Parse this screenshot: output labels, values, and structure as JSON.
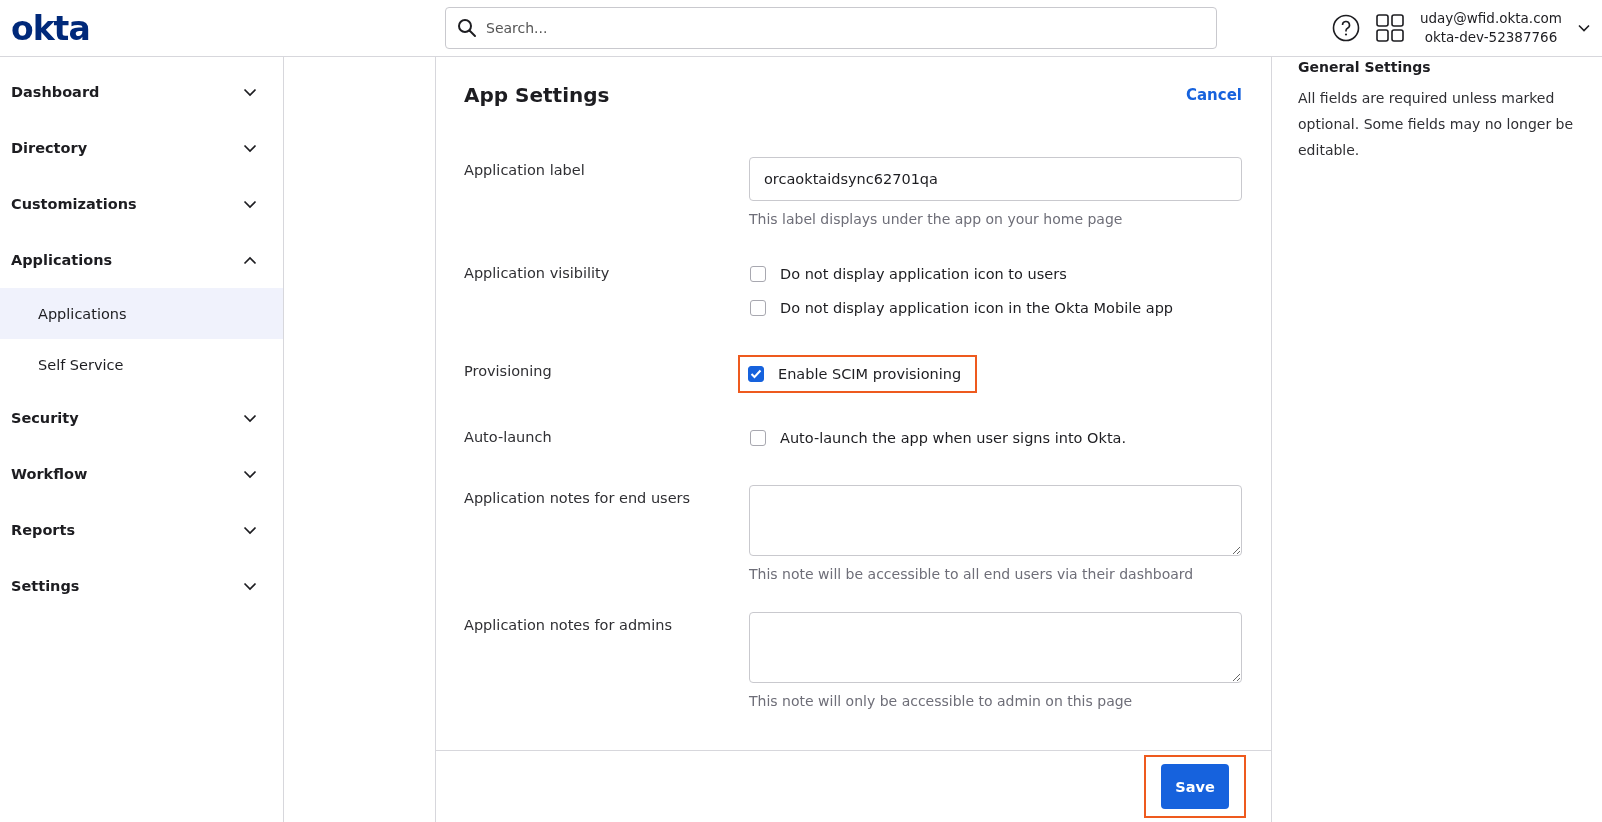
{
  "header": {
    "logo": "okta",
    "search": {
      "placeholder": "Search..."
    },
    "user": {
      "email": "uday@wfid.okta.com",
      "org": "okta-dev-52387766"
    }
  },
  "sidebar": {
    "items": [
      {
        "label": "Dashboard",
        "expanded": false
      },
      {
        "label": "Directory",
        "expanded": false
      },
      {
        "label": "Customizations",
        "expanded": false
      },
      {
        "label": "Applications",
        "expanded": true,
        "children": [
          {
            "label": "Applications",
            "selected": true
          },
          {
            "label": "Self Service",
            "selected": false
          }
        ]
      },
      {
        "label": "Security",
        "expanded": false
      },
      {
        "label": "Workflow",
        "expanded": false
      },
      {
        "label": "Reports",
        "expanded": false
      },
      {
        "label": "Settings",
        "expanded": false
      }
    ]
  },
  "form": {
    "title": "App Settings",
    "cancel": "Cancel",
    "rows": [
      {
        "kind": "text",
        "label": "Application label",
        "value": "orcaoktaidsync62701qa",
        "hint": "This label displays under the app on your home page"
      },
      {
        "kind": "checkboxes",
        "label": "Application visibility",
        "options": [
          {
            "label": "Do not display application icon to users",
            "checked": false,
            "highlighted": false
          },
          {
            "label": "Do not display application icon in the Okta Mobile app",
            "checked": false,
            "highlighted": false
          }
        ]
      },
      {
        "kind": "checkboxes",
        "label": "Provisioning",
        "options": [
          {
            "label": "Enable SCIM provisioning",
            "checked": true,
            "highlighted": true
          }
        ]
      },
      {
        "kind": "checkboxes",
        "label": "Auto-launch",
        "options": [
          {
            "label": "Auto-launch the app when user signs into Okta.",
            "checked": false,
            "highlighted": false
          }
        ]
      },
      {
        "kind": "textarea",
        "label": "Application notes for end users",
        "hint": "This note will be accessible to all end users via their dashboard"
      },
      {
        "kind": "textarea",
        "label": "Application notes for admins",
        "hint": "This note will only be accessible to admin on this page"
      }
    ],
    "save": {
      "label": "Save",
      "highlighted": true
    }
  },
  "help": {
    "title": "General Settings",
    "text": "All fields are required unless marked optional. Some fields may no longer be editable."
  }
}
